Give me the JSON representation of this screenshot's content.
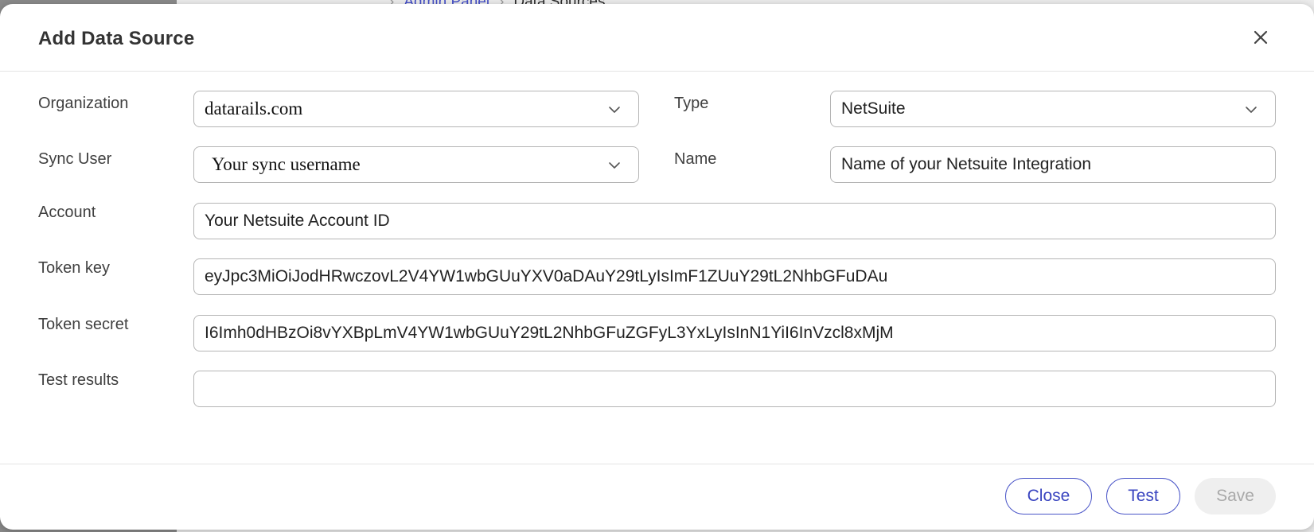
{
  "background": {
    "breadcrumb": [
      "Admin Panel",
      "Data Sources"
    ]
  },
  "dialog": {
    "title": "Add Data Source",
    "fields": {
      "organization": {
        "label": "Organization",
        "value": "datarails.com"
      },
      "type": {
        "label": "Type",
        "value": "NetSuite"
      },
      "sync_user": {
        "label": "Sync User",
        "value": "Your sync username"
      },
      "name": {
        "label": "Name",
        "value": "Name of your Netsuite Integration"
      },
      "account": {
        "label": "Account",
        "value": "Your Netsuite Account ID"
      },
      "token_key": {
        "label": "Token key",
        "value": "eyJpc3MiOiJodHRwczovL2V4YW1wbGUuYXV0aDAuY29tLyIsImF1ZUuY29tL2NhbGFuDAu"
      },
      "token_secret": {
        "label": "Token secret",
        "value": "I6Imh0dHBzOi8vYXBpLmV4YW1wbGUuY29tL2NhbGFuZGFyL3YxLyIsInN1YiI6InVzcl8xMjM"
      },
      "test_results": {
        "label": "Test results",
        "value": ""
      }
    },
    "buttons": {
      "close": "Close",
      "test": "Test",
      "save": "Save"
    },
    "icons": {
      "close": "close-icon",
      "dropdown": "chevron-down-icon"
    },
    "colors": {
      "accent": "#4a55c8",
      "disabled_bg": "#efefef",
      "disabled_text": "#a9a9a9"
    }
  }
}
